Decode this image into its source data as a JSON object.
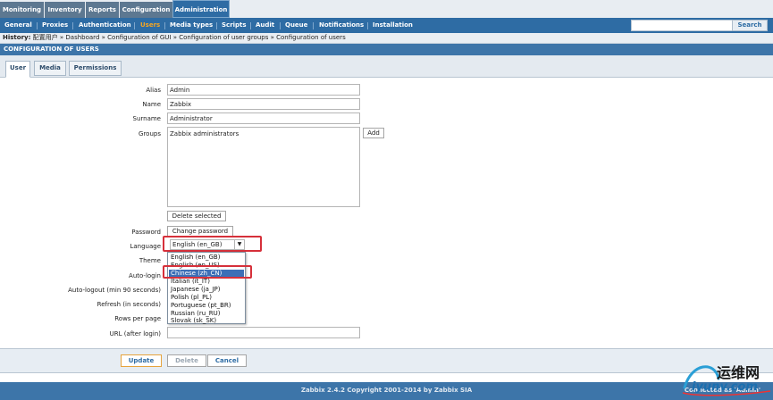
{
  "top_menu": {
    "items": [
      "Monitoring",
      "Inventory",
      "Reports",
      "Configuration",
      "Administration"
    ]
  },
  "sub_menu": {
    "items": [
      "General",
      "Proxies",
      "Authentication",
      "Users",
      "Media types",
      "Scripts",
      "Audit",
      "Queue",
      "Notifications",
      "Installation"
    ],
    "selected": "Users"
  },
  "search": {
    "button_label": "Search",
    "value": ""
  },
  "history": {
    "label": "History:",
    "items": [
      "配置用户",
      "Dashboard",
      "Configuration of GUI",
      "Configuration of user groups",
      "Configuration of users"
    ],
    "separator": "»"
  },
  "section_title": "CONFIGURATION OF USERS",
  "tabs": [
    "User",
    "Media",
    "Permissions"
  ],
  "active_tab": "User",
  "form": {
    "alias_label": "Alias",
    "alias_value": "Admin",
    "name_label": "Name",
    "name_value": "Zabbix",
    "surname_label": "Surname",
    "surname_value": "Administrator",
    "groups_label": "Groups",
    "groups_items": [
      "Zabbix administrators"
    ],
    "add_label": "Add",
    "delete_selected_label": "Delete selected",
    "password_label": "Password",
    "change_password_label": "Change password",
    "language_label": "Language",
    "language_value": "English (en_GB)",
    "theme_label": "Theme",
    "autologin_label": "Auto-login",
    "autologout_label": "Auto-logout (min 90 seconds)",
    "refresh_label": "Refresh (in seconds)",
    "rows_label": "Rows per page",
    "url_label": "URL (after login)",
    "url_value": ""
  },
  "language_options": [
    "English (en_GB)",
    "English (en_US)",
    "Chinese (zh_CN)",
    "Italian (it_IT)",
    "Japanese (ja_JP)",
    "Polish (pl_PL)",
    "Portuguese (pt_BR)",
    "Russian (ru_RU)",
    "Slovak (sk_SK)"
  ],
  "language_selected_option": "Chinese (zh_CN)",
  "actions": {
    "update_label": "Update",
    "delete_label": "Delete",
    "cancel_label": "Cancel"
  },
  "footer": {
    "copyright": "Zabbix 2.4.2 Copyright 2001-2014 by Zabbix SIA",
    "connected_text": "Connected as 'Admin'"
  },
  "watermark": {
    "cn_text": "运维网",
    "url_text": "iyunv.com"
  },
  "colors": {
    "menu_blue": "#2e6ca4",
    "header_blue": "#3d75a9",
    "highlight_red": "#d6303a",
    "selected_orange": "#f5a623",
    "selection_blue": "#3c6fb7"
  }
}
